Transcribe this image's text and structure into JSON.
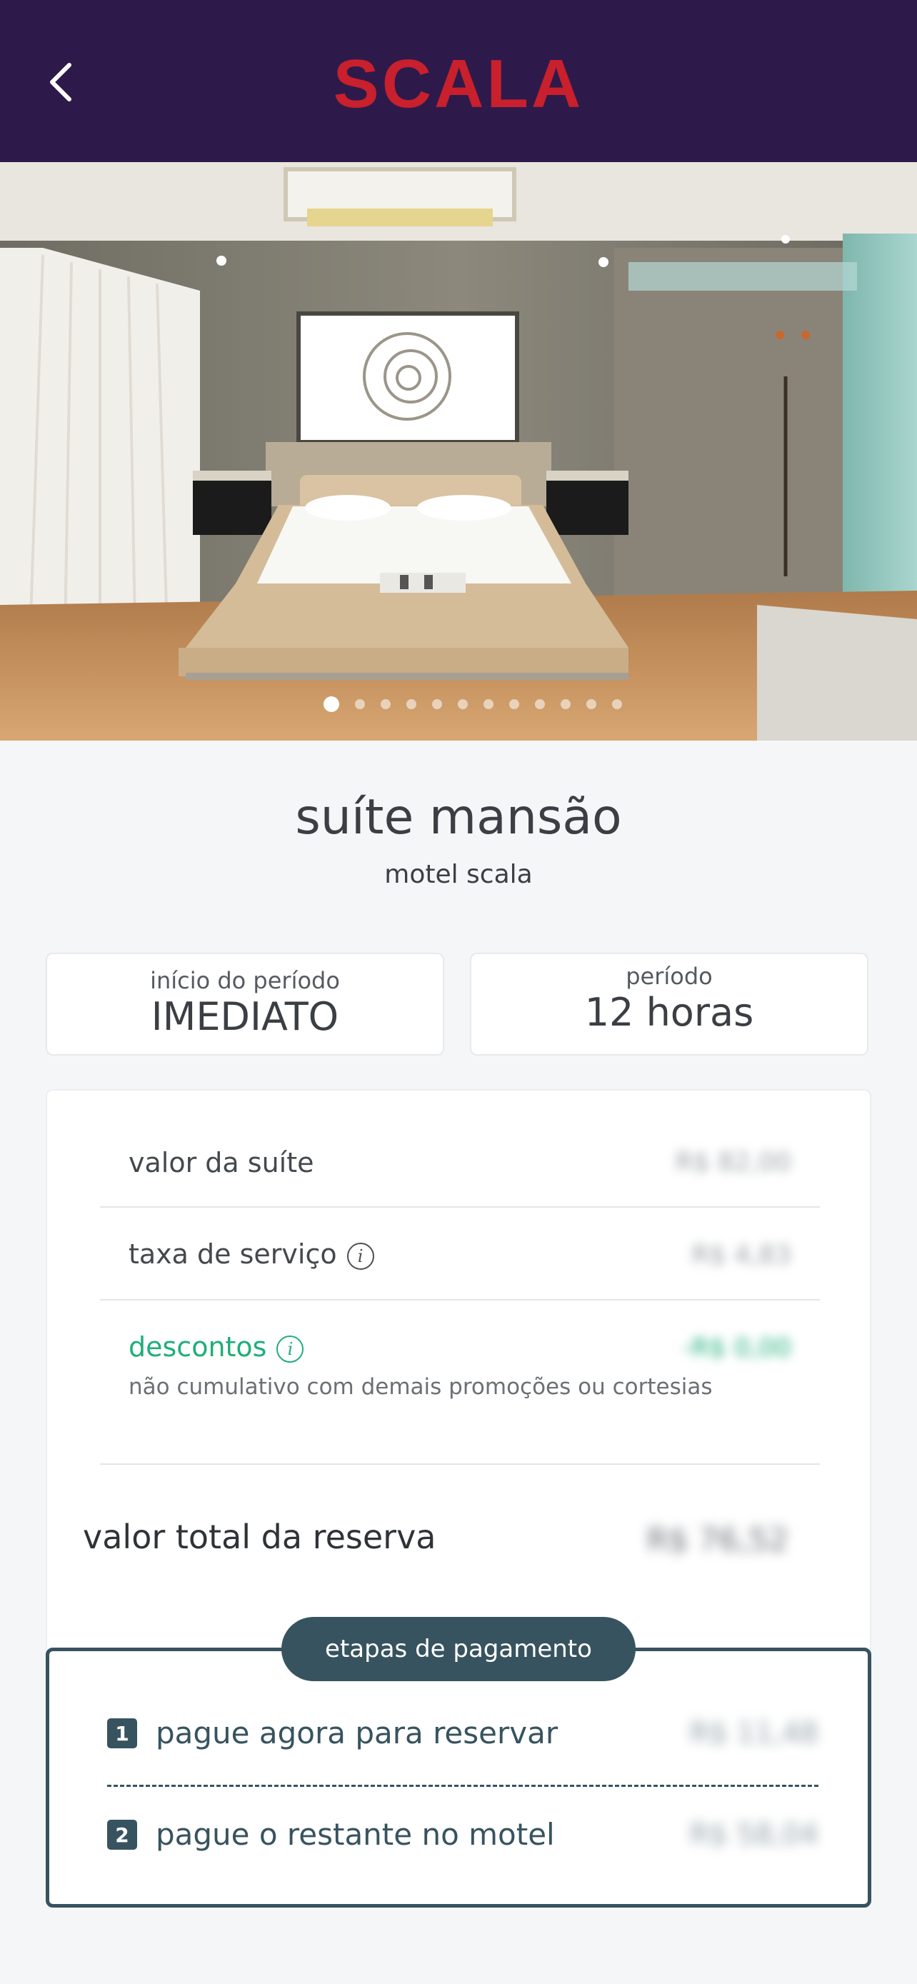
{
  "header": {
    "logo": "SCALA",
    "back_icon": "chevron-left-icon",
    "background": "#2e1a4a",
    "logo_color": "#c8202d"
  },
  "gallery": {
    "active_index": 0,
    "total": 12
  },
  "suite": {
    "title": "suíte mansão",
    "subtitle": "motel scala"
  },
  "period": {
    "start_label": "início do período",
    "start_value": "IMEDIATO",
    "duration_label": "período",
    "duration_value": "12 horas"
  },
  "pricing": {
    "suite_label": "valor da suíte",
    "suite_amount": "R$ 82,00",
    "service_label": "taxa de serviço",
    "service_amount": "R$ 4,83",
    "discount_label": "descontos",
    "discount_amount": "-R$ 0,00",
    "discount_note": "não cumulativo com demais promoções ou cortesias",
    "total_label": "valor total da reserva",
    "total_amount": "R$ 76,52",
    "discount_color": "#1fae7a"
  },
  "payment": {
    "heading": "etapas de pagamento",
    "steps": [
      {
        "number": "1",
        "label": "pague agora para reservar",
        "amount": "R$ 11,48"
      },
      {
        "number": "2",
        "label": "pague o restante no motel",
        "amount": "R$ 58,04"
      }
    ],
    "accent": "#37535f"
  }
}
